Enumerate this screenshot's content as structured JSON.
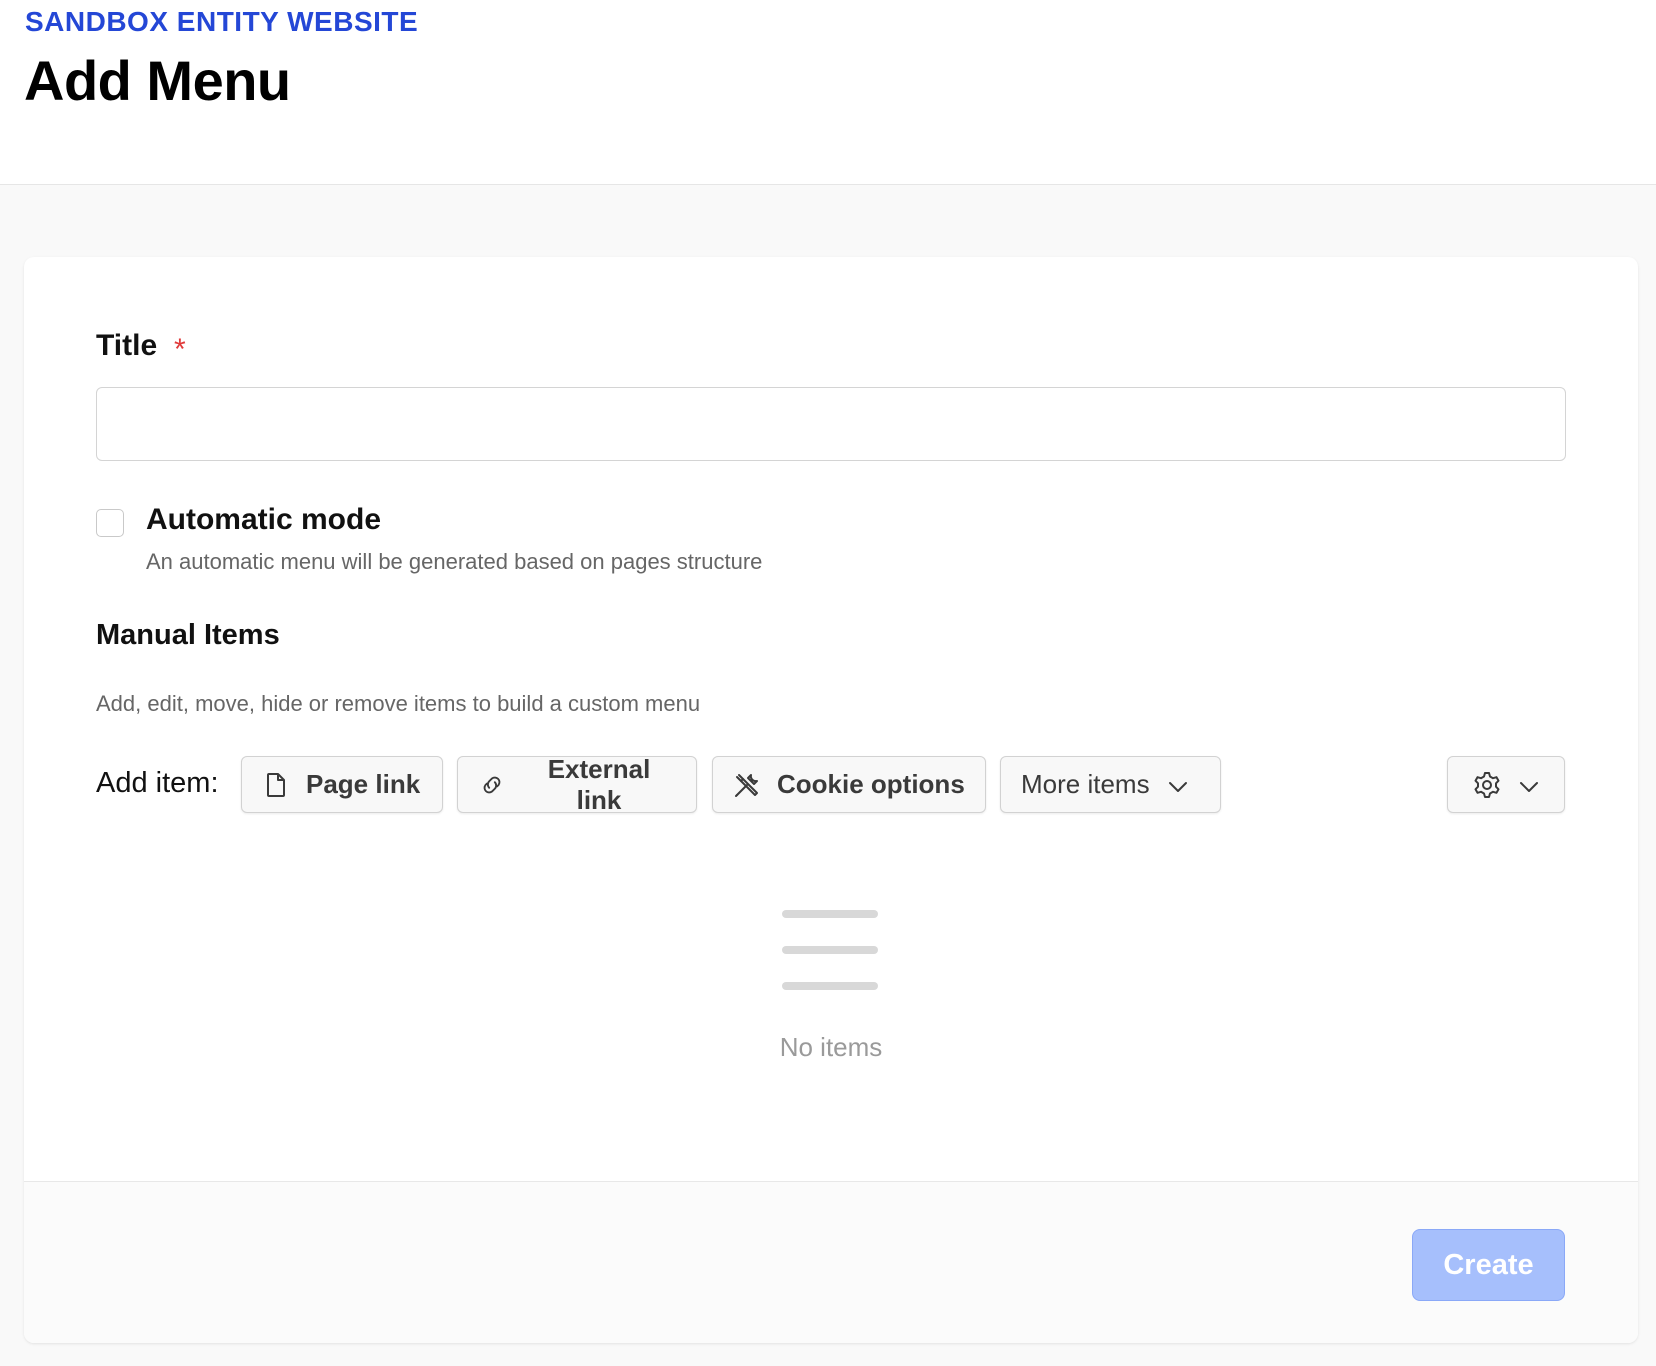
{
  "header": {
    "eyebrow": "SANDBOX ENTITY WEBSITE",
    "title": "Add Menu"
  },
  "form": {
    "title_label": "Title",
    "required_mark": "*",
    "title_value": "",
    "title_placeholder": "",
    "automatic_mode": {
      "label": "Automatic mode",
      "help": "An automatic menu will be generated based on pages structure",
      "checked": false
    },
    "manual_items": {
      "title": "Manual Items",
      "help": "Add, edit, move, hide or remove items to build a custom menu",
      "add_item_label": "Add item:",
      "buttons": [
        {
          "label": "Page link",
          "icon": "page-icon"
        },
        {
          "label": "External link",
          "icon": "link-icon"
        },
        {
          "label": "Cookie options",
          "icon": "tools-icon"
        },
        {
          "label": "More items",
          "icon": "chevron-down-icon"
        }
      ],
      "settings_icon": "gear-icon",
      "empty_icon": "list-icon",
      "empty_text": "No items"
    }
  },
  "footer": {
    "create_label": "Create"
  },
  "colors": {
    "accent": "#2447d6",
    "required": "#e03a3a",
    "create_disabled": "#a6bffc"
  }
}
